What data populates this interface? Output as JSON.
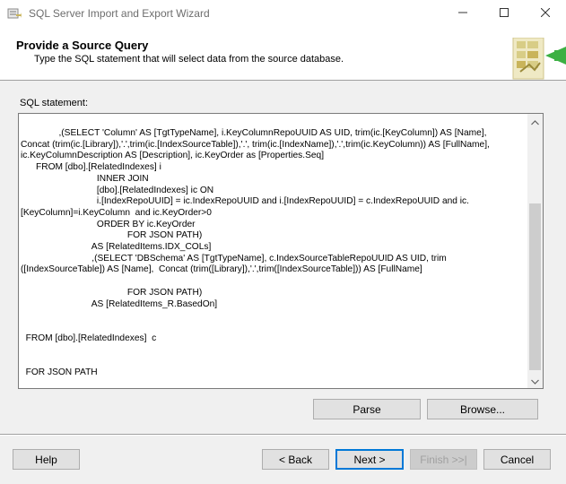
{
  "window": {
    "title": "SQL Server Import and Export Wizard"
  },
  "header": {
    "title": "Provide a Source Query",
    "subtitle": "Type the SQL statement that will select data from the source database."
  },
  "sql": {
    "label": "SQL statement:",
    "text": "               ,(SELECT 'Column' AS [TgtTypeName], i.KeyColumnRepoUUID AS UID, trim(ic.[KeyColumn]) AS [Name],\nConcat (trim(ic.[Library]),'.',trim(ic.[IndexSourceTable]),'.', trim(ic.[IndexName]),'.',trim(ic.KeyColumn)) AS [FullName],\nic.KeyColumnDescription AS [Description], ic.KeyOrder as [Properties.Seq]\n      FROM [dbo].[RelatedIndexes] i\n                              INNER JOIN\n                              [dbo].[RelatedIndexes] ic ON\n                              i.[IndexRepoUUID] = ic.IndexRepoUUID and i.[IndexRepoUUID] = c.IndexRepoUUID and ic.\n[KeyColumn]=i.KeyColumn  and ic.KeyOrder>0\n                              ORDER BY ic.KeyOrder\n                                          FOR JSON PATH)\n                            AS [RelatedItems.IDX_COLs]\n                            ,(SELECT 'DBSchema' AS [TgtTypeName], c.IndexSourceTableRepoUUID AS UID, trim\n([IndexSourceTable]) AS [Name],  Concat (trim([Library]),'.',trim([IndexSourceTable])) AS [FullName]\n\n                                          FOR JSON PATH)\n                            AS [RelatedItems_R.BasedOn]\n\n\n  FROM [dbo].[RelatedIndexes]  c\n\n\n  FOR JSON PATH"
  },
  "buttons": {
    "parse": "Parse",
    "browse": "Browse...",
    "help": "Help",
    "back": "< Back",
    "next": "Next >",
    "finish": "Finish >>|",
    "cancel": "Cancel"
  },
  "icons": {
    "app": "wizard-app-icon",
    "minimize": "minimize-icon",
    "maximize": "maximize-icon",
    "close": "close-icon",
    "header_graphic": "data-transfer-icon",
    "scroll_up": "chevron-up-icon",
    "scroll_down": "chevron-down-icon"
  },
  "colors": {
    "default_button_border": "#0078d7",
    "header_bg": "#ffffff",
    "graphic_green": "#3cb043",
    "graphic_yellow": "#d4c97a"
  }
}
